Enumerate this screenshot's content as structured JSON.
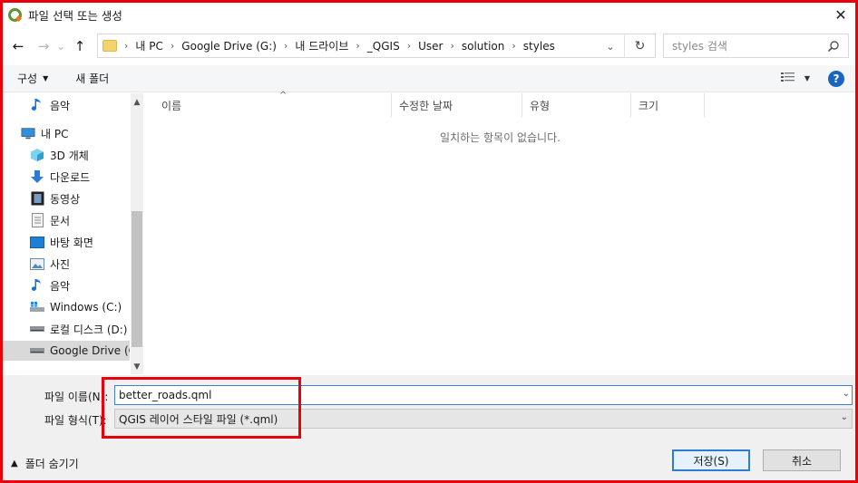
{
  "window": {
    "title": "파일 선택 또는 생성",
    "close_label": "✕"
  },
  "nav": {
    "back": "←",
    "forward": "→",
    "recent": "⌄",
    "up": "↑",
    "breadcrumbs": [
      "내 PC",
      "Google Drive (G:)",
      "내 드라이브",
      "_QGIS",
      "User",
      "solution",
      "styles"
    ],
    "refresh": "↻",
    "search_placeholder": "styles 검색"
  },
  "toolbar": {
    "organize_label": "구성",
    "new_folder_label": "새 폴더"
  },
  "sidebar": {
    "items": [
      {
        "label": "음악",
        "icon": "music-icon"
      },
      {
        "label": "내 PC",
        "icon": "pc-icon"
      },
      {
        "label": "3D 개체",
        "icon": "3d-objects-icon"
      },
      {
        "label": "다운로드",
        "icon": "download-icon"
      },
      {
        "label": "동영상",
        "icon": "video-icon"
      },
      {
        "label": "문서",
        "icon": "document-icon"
      },
      {
        "label": "바탕 화면",
        "icon": "desktop-icon"
      },
      {
        "label": "사진",
        "icon": "pictures-icon"
      },
      {
        "label": "음악",
        "icon": "music-icon"
      },
      {
        "label": "Windows (C:)",
        "icon": "windows-drive-icon"
      },
      {
        "label": "로컬 디스크 (D:)",
        "icon": "drive-icon"
      },
      {
        "label": "Google Drive (G:)",
        "icon": "drive-icon",
        "selected": true
      }
    ]
  },
  "filelist": {
    "columns": [
      "이름",
      "수정한 날짜",
      "유형",
      "크기"
    ],
    "empty_message": "일치하는 항목이 없습니다."
  },
  "form": {
    "filename_label": "파일 이름(N):",
    "filename_value": "better_roads.qml",
    "filetype_label": "파일 형식(T):",
    "filetype_value": "QGIS 레이어 스타일 파일 (*.qml)",
    "hide_folders_label": "폴더 숨기기",
    "save_label": "저장(S)",
    "cancel_label": "취소"
  },
  "colors": {
    "highlight": "#e8000b",
    "accent": "#2e7bd2"
  }
}
